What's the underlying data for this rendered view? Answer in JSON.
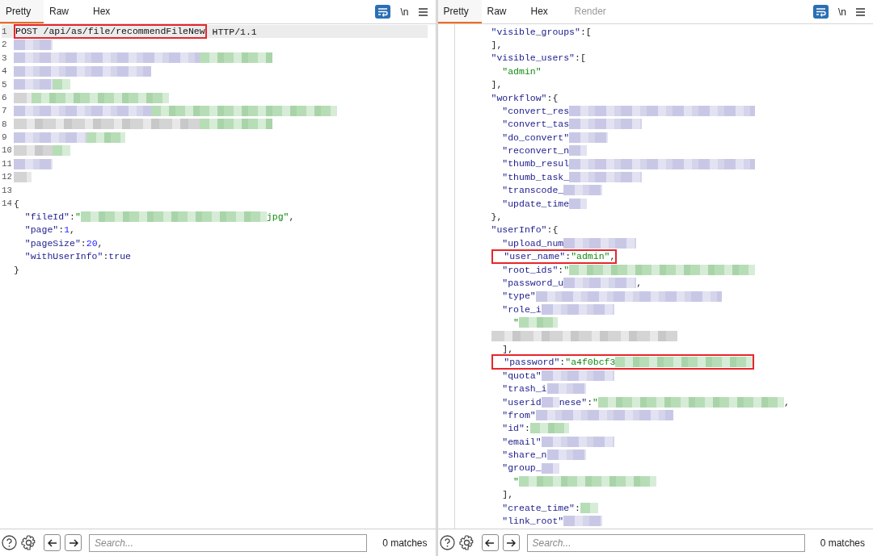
{
  "panes": [
    {
      "tabs": [
        {
          "label": "Pretty",
          "selected": true,
          "disabled": false
        },
        {
          "label": "Raw",
          "selected": false,
          "disabled": false
        },
        {
          "label": "Hex",
          "selected": false,
          "disabled": false
        }
      ],
      "newline_label": "\\n",
      "lines": [
        {
          "number": "1",
          "current": true,
          "tokens": [
            {
              "kind": "plain",
              "text": "POST /api/as/file/recommendFileNew",
              "boxed": true
            },
            {
              "kind": "plain",
              "text": " HTTP/1.1"
            }
          ]
        },
        {
          "number": "2",
          "current": false,
          "tokens": [
            {
              "kind": "blur"
            }
          ]
        },
        {
          "number": "3",
          "current": false,
          "tokens": [
            {
              "kind": "blur"
            },
            {
              "kind": "blur"
            }
          ]
        },
        {
          "number": "4",
          "current": false,
          "tokens": [
            {
              "kind": "blur"
            }
          ]
        },
        {
          "number": "5",
          "current": false,
          "tokens": [
            {
              "kind": "blur"
            },
            {
              "kind": "blur"
            }
          ]
        },
        {
          "number": "6",
          "current": false,
          "tokens": [
            {
              "kind": "blur"
            },
            {
              "kind": "blur"
            }
          ]
        },
        {
          "number": "7",
          "current": false,
          "tokens": [
            {
              "kind": "blur"
            },
            {
              "kind": "blur"
            }
          ]
        },
        {
          "number": "8",
          "current": false,
          "tokens": [
            {
              "kind": "blur"
            },
            {
              "kind": "blur"
            }
          ]
        },
        {
          "number": "9",
          "current": false,
          "tokens": [
            {
              "kind": "blur"
            },
            {
              "kind": "blur"
            }
          ]
        },
        {
          "number": "10",
          "current": false,
          "tokens": [
            {
              "kind": "blur"
            },
            {
              "kind": "blur"
            }
          ]
        },
        {
          "number": "11",
          "current": false,
          "tokens": [
            {
              "kind": "blur"
            }
          ]
        },
        {
          "number": "12",
          "current": false,
          "tokens": [
            {
              "kind": "blur"
            }
          ]
        },
        {
          "number": "13",
          "current": false
        },
        {
          "number": "14",
          "current": false,
          "tokens": [
            {
              "kind": "punct",
              "text": "{"
            }
          ]
        },
        {
          "current": false,
          "tokens": [
            {
              "kind": "key",
              "text": "  \"fileId\""
            },
            {
              "kind": "punct",
              "text": ":"
            },
            {
              "kind": "str",
              "text": "\""
            },
            {
              "kind": "blur"
            },
            {
              "kind": "str",
              "text": "jpg\""
            },
            {
              "kind": "punct",
              "text": ","
            }
          ]
        },
        {
          "current": false,
          "tokens": [
            {
              "kind": "key",
              "text": "  \"page\""
            },
            {
              "kind": "punct",
              "text": ":"
            },
            {
              "kind": "num",
              "text": "1"
            },
            {
              "kind": "punct",
              "text": ","
            }
          ]
        },
        {
          "current": false,
          "tokens": [
            {
              "kind": "key",
              "text": "  \"pageSize\""
            },
            {
              "kind": "punct",
              "text": ":"
            },
            {
              "kind": "num",
              "text": "20"
            },
            {
              "kind": "punct",
              "text": ","
            }
          ]
        },
        {
          "current": false,
          "tokens": [
            {
              "kind": "key",
              "text": "  \"withUserInfo\""
            },
            {
              "kind": "punct",
              "text": ":"
            },
            {
              "kind": "kw",
              "text": "true"
            }
          ]
        },
        {
          "current": false,
          "tokens": [
            {
              "kind": "punct",
              "text": "}"
            }
          ]
        }
      ],
      "search": {
        "placeholder": "Search..."
      },
      "matches": "0 matches"
    },
    {
      "tabs": [
        {
          "label": "Pretty",
          "selected": true,
          "disabled": false
        },
        {
          "label": "Raw",
          "selected": false,
          "disabled": false
        },
        {
          "label": "Hex",
          "selected": false,
          "disabled": false
        },
        {
          "label": "Render",
          "selected": false,
          "disabled": true
        }
      ],
      "newline_label": "\\n",
      "lines": [
        {
          "current": false,
          "tokens": [
            {
              "kind": "key",
              "text": "\"visible_groups\""
            },
            {
              "kind": "punct",
              "text": ":["
            }
          ]
        },
        {
          "current": false,
          "tokens": [
            {
              "kind": "punct",
              "text": "],"
            }
          ]
        },
        {
          "current": false,
          "tokens": [
            {
              "kind": "key",
              "text": "\"visible_users\""
            },
            {
              "kind": "punct",
              "text": ":["
            }
          ]
        },
        {
          "current": false,
          "tokens": [
            {
              "kind": "str",
              "text": "  \"admin\""
            }
          ]
        },
        {
          "current": false,
          "tokens": [
            {
              "kind": "punct",
              "text": "],"
            }
          ]
        },
        {
          "current": false,
          "tokens": [
            {
              "kind": "key",
              "text": "\"workflow\""
            },
            {
              "kind": "punct",
              "text": ":{"
            }
          ]
        },
        {
          "current": false,
          "tokens": [
            {
              "kind": "key",
              "text": "  \"convert_res"
            },
            {
              "kind": "blur"
            }
          ]
        },
        {
          "current": false,
          "tokens": [
            {
              "kind": "key",
              "text": "  \"convert_tas"
            },
            {
              "kind": "blur"
            }
          ]
        },
        {
          "current": false,
          "tokens": [
            {
              "kind": "key",
              "text": "  \"do_convert\""
            },
            {
              "kind": "blur"
            }
          ]
        },
        {
          "current": false,
          "tokens": [
            {
              "kind": "key",
              "text": "  \"reconvert_n"
            },
            {
              "kind": "blur"
            }
          ]
        },
        {
          "current": false,
          "tokens": [
            {
              "kind": "key",
              "text": "  \"thumb_resul"
            },
            {
              "kind": "blur"
            }
          ]
        },
        {
          "current": false,
          "tokens": [
            {
              "kind": "key",
              "text": "  \"thumb_task_"
            },
            {
              "kind": "blur"
            }
          ]
        },
        {
          "current": false,
          "tokens": [
            {
              "kind": "key",
              "text": "  \"transcode_"
            },
            {
              "kind": "blur"
            }
          ]
        },
        {
          "current": false,
          "tokens": [
            {
              "kind": "key",
              "text": "  \"update_time"
            },
            {
              "kind": "blur"
            }
          ]
        },
        {
          "current": false,
          "tokens": [
            {
              "kind": "punct",
              "text": "},"
            }
          ]
        },
        {
          "current": false,
          "tokens": [
            {
              "kind": "key",
              "text": "\"userInfo\""
            },
            {
              "kind": "punct",
              "text": ":{"
            }
          ]
        },
        {
          "current": false,
          "tokens": [
            {
              "kind": "key",
              "text": "  \"upload_num"
            },
            {
              "kind": "blur"
            }
          ]
        },
        {
          "current": false,
          "tokens": [
            {
              "kind": "key",
              "text": "  \"user_name\"",
              "boxed": true
            },
            {
              "kind": "punct",
              "text": ":",
              "boxed": true
            },
            {
              "kind": "str",
              "text": "\"admin\"",
              "boxed": true
            },
            {
              "kind": "punct",
              "text": ",",
              "boxed": true
            }
          ]
        },
        {
          "current": false,
          "tokens": [
            {
              "kind": "key",
              "text": "  \"root_ids\""
            },
            {
              "kind": "punct",
              "text": ":"
            },
            {
              "kind": "str",
              "text": "\""
            },
            {
              "kind": "blur"
            }
          ]
        },
        {
          "current": false,
          "tokens": [
            {
              "kind": "key",
              "text": "  \"password_u"
            },
            {
              "kind": "blur"
            },
            {
              "kind": "punct",
              "text": ","
            }
          ]
        },
        {
          "current": false,
          "tokens": [
            {
              "kind": "key",
              "text": "  \"type\""
            },
            {
              "kind": "blur"
            }
          ]
        },
        {
          "current": false,
          "tokens": [
            {
              "kind": "key",
              "text": "  \"role_i"
            },
            {
              "kind": "blur"
            }
          ]
        },
        {
          "current": false,
          "tokens": [
            {
              "kind": "str",
              "text": "    \""
            },
            {
              "kind": "blur"
            }
          ]
        },
        {
          "current": false,
          "tokens": [
            {
              "kind": "blur"
            }
          ]
        },
        {
          "current": false,
          "tokens": [
            {
              "kind": "punct",
              "text": "  ],"
            }
          ]
        },
        {
          "current": false,
          "tokens": [
            {
              "kind": "key",
              "text": "  \"password\"",
              "boxed": true
            },
            {
              "kind": "punct",
              "text": ":",
              "boxed": true
            },
            {
              "kind": "str",
              "text": "\"a4f0bcf3",
              "boxed": true
            },
            {
              "kind": "blur",
              "boxed": true
            }
          ]
        },
        {
          "current": false,
          "tokens": [
            {
              "kind": "key",
              "text": "  \"quota\""
            },
            {
              "kind": "blur"
            }
          ]
        },
        {
          "current": false,
          "tokens": [
            {
              "kind": "key",
              "text": "  \"trash_i"
            },
            {
              "kind": "blur"
            }
          ]
        },
        {
          "current": false,
          "tokens": [
            {
              "kind": "key",
              "text": "  \"userid"
            },
            {
              "kind": "blur"
            },
            {
              "kind": "key",
              "text": "nese\""
            },
            {
              "kind": "punct",
              "text": ":"
            },
            {
              "kind": "str",
              "text": "\""
            },
            {
              "kind": "blur"
            },
            {
              "kind": "punct",
              "text": ","
            }
          ]
        },
        {
          "current": false,
          "tokens": [
            {
              "kind": "key",
              "text": "  \"from\""
            },
            {
              "kind": "blur"
            }
          ]
        },
        {
          "current": false,
          "tokens": [
            {
              "kind": "key",
              "text": "  \"id\""
            },
            {
              "kind": "punct",
              "text": ":"
            },
            {
              "kind": "blur"
            }
          ]
        },
        {
          "current": false,
          "tokens": [
            {
              "kind": "key",
              "text": "  \"email\""
            },
            {
              "kind": "blur"
            }
          ]
        },
        {
          "current": false,
          "tokens": [
            {
              "kind": "key",
              "text": "  \"share_n"
            },
            {
              "kind": "blur"
            }
          ]
        },
        {
          "current": false,
          "tokens": [
            {
              "kind": "key",
              "text": "  \"group_"
            },
            {
              "kind": "blur"
            }
          ]
        },
        {
          "current": false,
          "tokens": [
            {
              "kind": "str",
              "text": "    \""
            },
            {
              "kind": "blur"
            }
          ]
        },
        {
          "current": false,
          "tokens": [
            {
              "kind": "punct",
              "text": "  ],"
            }
          ]
        },
        {
          "current": false,
          "tokens": [
            {
              "kind": "key",
              "text": "  \"create_time\""
            },
            {
              "kind": "punct",
              "text": ":"
            },
            {
              "kind": "blur"
            }
          ]
        },
        {
          "current": false,
          "tokens": [
            {
              "kind": "key",
              "text": "  \"link_root\""
            },
            {
              "kind": "blur"
            }
          ]
        }
      ],
      "search": {
        "placeholder": "Search..."
      },
      "matches": "0 matches"
    }
  ]
}
